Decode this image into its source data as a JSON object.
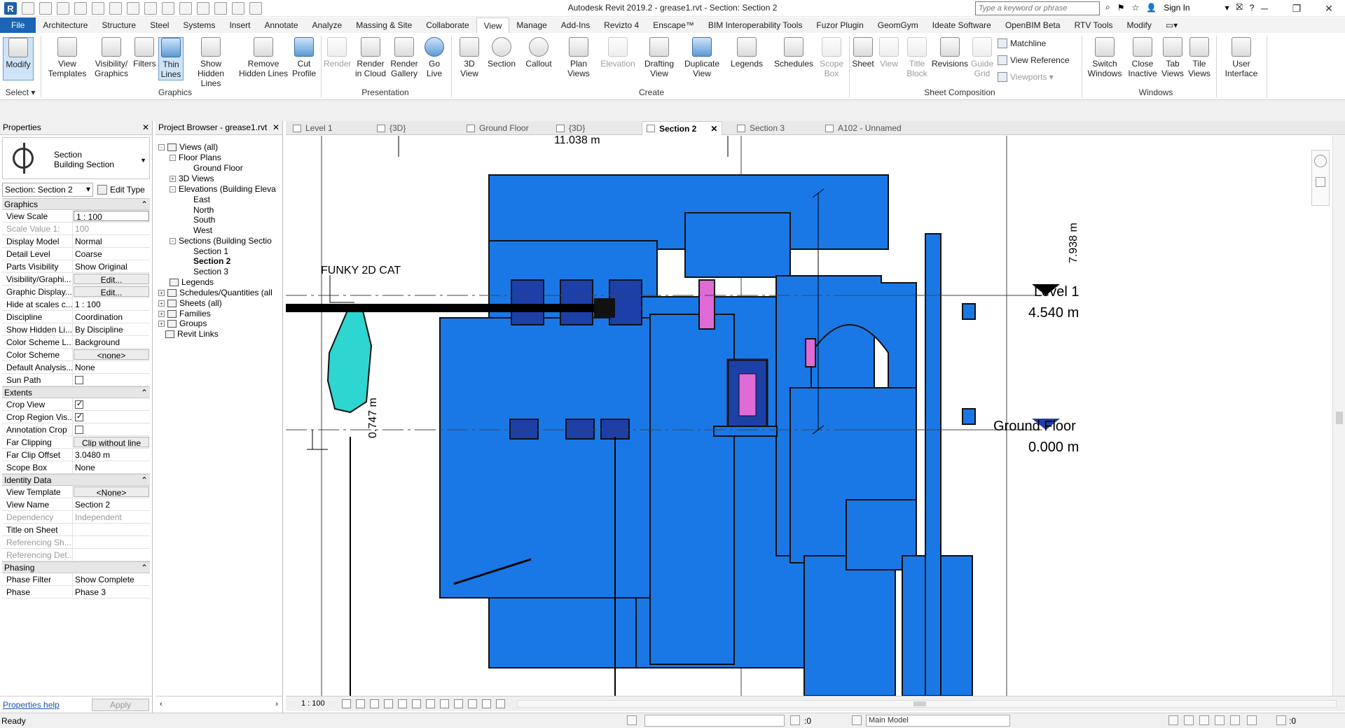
{
  "titlebar": {
    "title": "Autodesk Revit 2019.2 - grease1.rvt - Section: Section 2",
    "search_placeholder": "Type a keyword or phrase",
    "sign_in": "Sign In"
  },
  "ribbon_tabs": [
    "File",
    "Architecture",
    "Structure",
    "Steel",
    "Systems",
    "Insert",
    "Annotate",
    "Analyze",
    "Massing & Site",
    "Collaborate",
    "View",
    "Manage",
    "Add-Ins",
    "Revizto 4",
    "Enscape™",
    "BIM Interoperability Tools",
    "Fuzor Plugin",
    "GeomGym",
    "Ideate Software",
    "OpenBIM Beta",
    "RTV Tools",
    "Modify"
  ],
  "ribbon": {
    "modify": "Modify",
    "select": "Select ▾",
    "graphics": [
      "View Templates",
      "Visibility/ Graphics",
      "Filters",
      "Thin Lines",
      "Show Hidden Lines",
      "Remove Hidden Lines",
      "Cut Profile"
    ],
    "graphics_label": "Graphics",
    "presentation": [
      "Render",
      "Render in Cloud",
      "Render Gallery",
      "Go Live"
    ],
    "presentation_label": "Presentation",
    "create": [
      "3D View",
      "Section",
      "Callout",
      "Plan Views",
      "Elevation",
      "Drafting View",
      "Duplicate View",
      "Legends",
      "Schedules",
      "Scope Box"
    ],
    "create_label": "Create",
    "sheet": [
      "Sheet",
      "View",
      "Title Block",
      "Revisions",
      "Guide Grid"
    ],
    "sheet_small": [
      "Matchline",
      "View Reference",
      "Viewports ▾"
    ],
    "sheet_label": "Sheet Composition",
    "windows": [
      "Switch Windows",
      "Close Inactive",
      "Tab Views",
      "Tile Views"
    ],
    "windows_label": "Windows",
    "ui": "User Interface"
  },
  "properties": {
    "header": "Properties",
    "type_line1": "Section",
    "type_line2": "Building Section",
    "instance": "Section: Section 2",
    "edit_type": "Edit Type",
    "sections": {
      "graphics": "Graphics",
      "extents": "Extents",
      "identity": "Identity Data",
      "phasing": "Phasing"
    },
    "graphics_rows": [
      {
        "k": "View Scale",
        "v": "1 : 100"
      },
      {
        "k": "Scale Value    1:",
        "v": "100"
      },
      {
        "k": "Display Model",
        "v": "Normal"
      },
      {
        "k": "Detail Level",
        "v": "Coarse"
      },
      {
        "k": "Parts Visibility",
        "v": "Show Original"
      },
      {
        "k": "Visibility/Graphi...",
        "v": "Edit..."
      },
      {
        "k": "Graphic Display...",
        "v": "Edit..."
      },
      {
        "k": "Hide at scales c...",
        "v": "1 : 100"
      },
      {
        "k": "Discipline",
        "v": "Coordination"
      },
      {
        "k": "Show Hidden Li...",
        "v": "By Discipline"
      },
      {
        "k": "Color Scheme L...",
        "v": "Background"
      },
      {
        "k": "Color Scheme",
        "v": "<none>"
      },
      {
        "k": "Default Analysis...",
        "v": "None"
      },
      {
        "k": "Sun Path",
        "v": ""
      }
    ],
    "extents_rows": [
      {
        "k": "Crop View",
        "v": ""
      },
      {
        "k": "Crop Region Vis...",
        "v": ""
      },
      {
        "k": "Annotation Crop",
        "v": ""
      },
      {
        "k": "Far Clipping",
        "v": "Clip without line"
      },
      {
        "k": "Far Clip Offset",
        "v": "3.0480 m"
      },
      {
        "k": "Scope Box",
        "v": "None"
      }
    ],
    "identity_rows": [
      {
        "k": "View Template",
        "v": "<None>"
      },
      {
        "k": "View Name",
        "v": "Section 2"
      },
      {
        "k": "Dependency",
        "v": "Independent"
      },
      {
        "k": "Title on Sheet",
        "v": ""
      },
      {
        "k": "Referencing Sh...",
        "v": ""
      },
      {
        "k": "Referencing Det...",
        "v": ""
      }
    ],
    "phasing_rows": [
      {
        "k": "Phase Filter",
        "v": "Show Complete"
      },
      {
        "k": "Phase",
        "v": "Phase 3"
      }
    ],
    "help": "Properties help",
    "apply": "Apply"
  },
  "browser": {
    "header": "Project Browser - grease1.rvt",
    "nodes": [
      "Views (all)",
      "Floor Plans",
      "Ground Floor",
      "3D Views",
      "Elevations (Building Eleva",
      "East",
      "North",
      "South",
      "West",
      "Sections (Building Sectio",
      "Section 1",
      "Section 2",
      "Section 3",
      "Legends",
      "Schedules/Quantities (all",
      "Sheets (all)",
      "Families",
      "Groups",
      "Revit Links"
    ]
  },
  "view_tabs": [
    "Level 1",
    "{3D}",
    "Ground Floor",
    "{3D}",
    "Section 2",
    "Section 3",
    "A102 - Unnamed"
  ],
  "canvas": {
    "dim_width": "11.038 m",
    "dim_height": "7.938 m",
    "dim_small": "0.747 m",
    "label_cat": "FUNKY 2D CAT",
    "level1_name": "Level 1",
    "level1_elev": "4.540 m",
    "ground_name": "Ground Floor",
    "ground_elev": "0.000 m",
    "colors": {
      "building": "#1a78e6",
      "dark": "#1d3fa8",
      "cat": "#2fd5d0",
      "pink": "#e06ad6"
    }
  },
  "view_control": {
    "scale": "1 : 100"
  },
  "status": {
    "ready": "Ready",
    "zero1": ":0",
    "model": "Main Model",
    "zero2": ":0"
  }
}
